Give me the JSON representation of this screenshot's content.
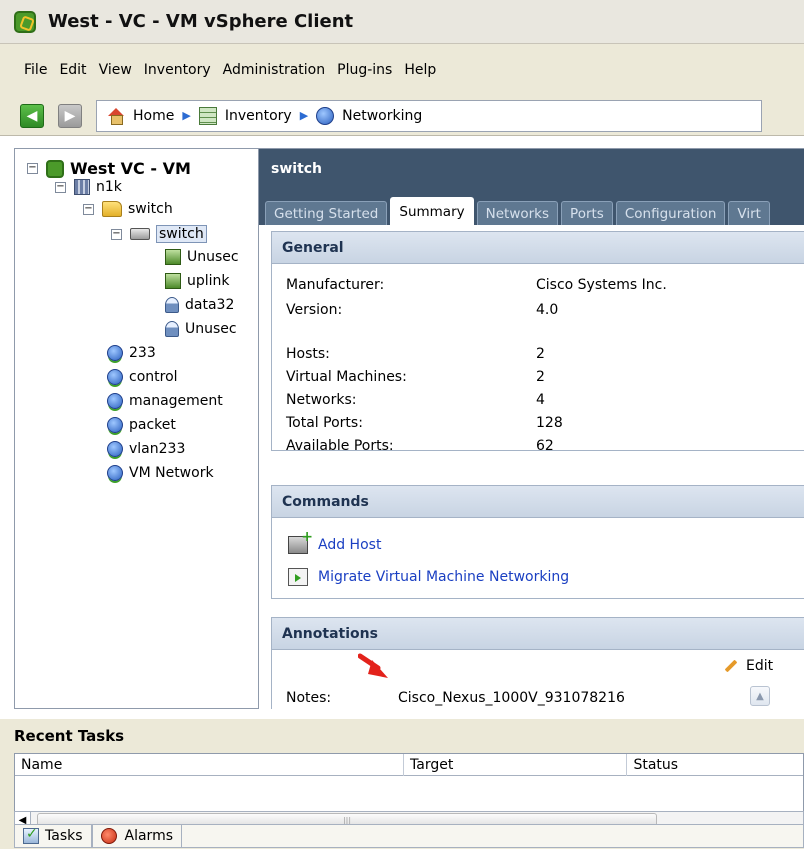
{
  "window": {
    "title": "West - VC - VM vSphere Client"
  },
  "menu": [
    "File",
    "Edit",
    "View",
    "Inventory",
    "Administration",
    "Plug-ins",
    "Help"
  ],
  "breadcrumb": [
    "Home",
    "Inventory",
    "Networking"
  ],
  "tree": {
    "root": "West VC - VM",
    "datacenter": "n1k",
    "folder": "switch",
    "dvswitch": "switch",
    "portgroups": [
      "Unusec",
      "uplink",
      "data32",
      "Unusec"
    ],
    "networks": [
      "233",
      "control",
      "management",
      "packet",
      "vlan233",
      "VM Network"
    ]
  },
  "panel": {
    "object_title": "switch",
    "tabs": [
      "Getting Started",
      "Summary",
      "Networks",
      "Ports",
      "Configuration",
      "Virt"
    ],
    "active_tab": "Summary",
    "general": {
      "title": "General",
      "rows": [
        {
          "label": "Manufacturer:",
          "value": "Cisco Systems Inc."
        },
        {
          "label": "Version:",
          "value": "4.0"
        },
        {
          "label": "Hosts:",
          "value": "2"
        },
        {
          "label": "Virtual Machines:",
          "value": "2"
        },
        {
          "label": "Networks:",
          "value": "4"
        },
        {
          "label": "Total Ports:",
          "value": "128"
        },
        {
          "label": "Available Ports:",
          "value": "62"
        }
      ]
    },
    "commands": {
      "title": "Commands",
      "items": [
        "Add Host",
        "Migrate Virtual Machine Networking"
      ]
    },
    "annotations": {
      "title": "Annotations",
      "edit_label": "Edit",
      "notes_label": "Notes:",
      "notes_value": "Cisco_Nexus_1000V_931078216"
    }
  },
  "recent_tasks": {
    "title": "Recent Tasks",
    "columns": [
      "Name",
      "Target",
      "Status"
    ],
    "tabs": [
      "Tasks",
      "Alarms"
    ]
  },
  "colors": {
    "header_bg": "#3f556d",
    "link": "#1a3fc2",
    "annotation_arrow": "#e3221b"
  }
}
